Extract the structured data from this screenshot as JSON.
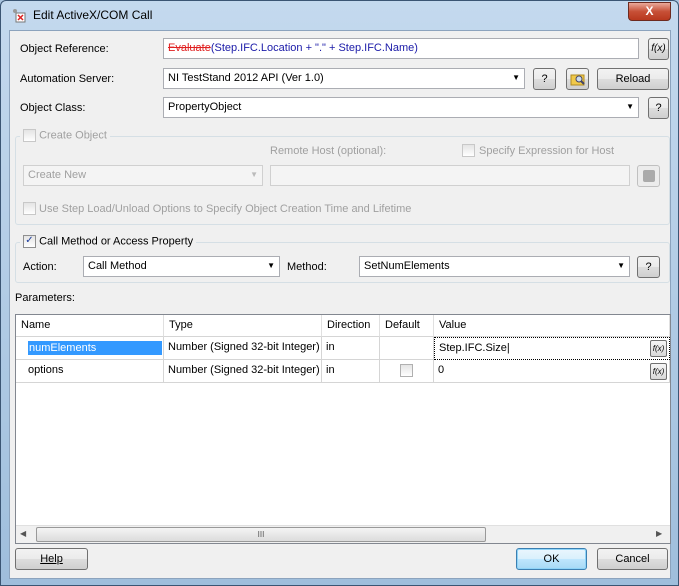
{
  "window": {
    "title": "Edit ActiveX/COM Call",
    "close": "X"
  },
  "object_reference": {
    "label": "Object Reference:",
    "prefix": "Evaluate",
    "rest": "(Step.IFC.Location + \".\" + Step.IFC.Name)",
    "fx": "f(x)"
  },
  "automation_server": {
    "label": "Automation Server:",
    "value": "NI TestStand 2012 API (Ver 1.0)",
    "help": "?",
    "reload": "Reload"
  },
  "object_class": {
    "label": "Object Class:",
    "value": "PropertyObject",
    "help": "?"
  },
  "create_object": {
    "label": "Create Object",
    "checked": false,
    "remote_host_label": "Remote Host (optional):",
    "specify_expr_label": "Specify Expression for Host",
    "mode": "Create New",
    "remote_host_value": "",
    "use_step_load": "Use Step Load/Unload Options to Specify Object Creation Time and Lifetime"
  },
  "call_method": {
    "label": "Call Method or Access Property",
    "checked": true,
    "action_label": "Action:",
    "action_value": "Call Method",
    "method_label": "Method:",
    "method_value": "SetNumElements",
    "help": "?"
  },
  "parameters": {
    "label": "Parameters:",
    "columns": [
      "Name",
      "Type",
      "Direction",
      "Default",
      "Value"
    ],
    "rows": [
      {
        "name": "numElements",
        "type": "Number (Signed 32-bit Integer)",
        "direction": "in",
        "default": "",
        "value": "Step.IFC.Size"
      },
      {
        "name": "options",
        "type": "Number (Signed 32-bit Integer)",
        "direction": "in",
        "default": "unchecked",
        "value": "0"
      }
    ],
    "scroll_grip": "III"
  },
  "footer": {
    "help": "Help",
    "ok": "OK",
    "cancel": "Cancel"
  }
}
